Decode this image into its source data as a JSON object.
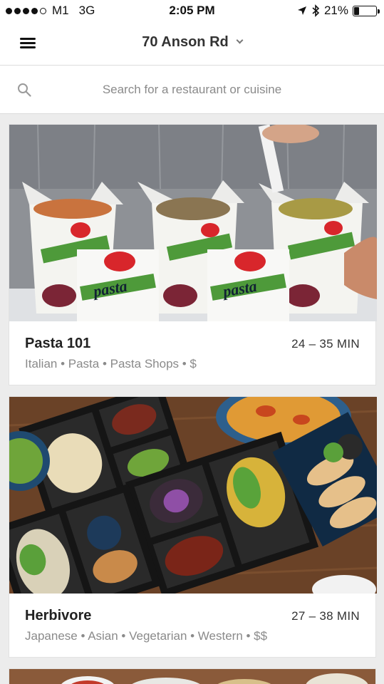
{
  "status_bar": {
    "carrier": "M1",
    "network": "3G",
    "time": "2:05 PM",
    "battery_percent": "21%",
    "battery_level": 0.21,
    "icons": [
      "signal-dots-icon",
      "location-arrow-icon",
      "bluetooth-icon",
      "battery-icon"
    ]
  },
  "header": {
    "menu_icon": "hamburger-menu-icon",
    "location": "70 Anson Rd",
    "dropdown_icon": "chevron-down-icon"
  },
  "search": {
    "icon": "search-icon",
    "placeholder": "Search for a restaurant or cuisine"
  },
  "restaurants": [
    {
      "name": "Pasta 101",
      "eta": "24 – 35 MIN",
      "tags": "Italian • Pasta • Pasta Shops • $",
      "image_text": "pasta"
    },
    {
      "name": "Herbivore",
      "eta": "27 – 38 MIN",
      "tags": "Japanese • Asian • Vegetarian • Western • $$"
    },
    {}
  ]
}
